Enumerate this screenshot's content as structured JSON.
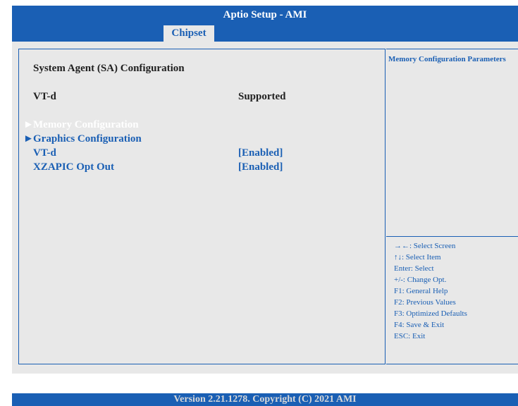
{
  "header": {
    "title": "Aptio Setup - AMI"
  },
  "tabs": [
    {
      "label": "Chipset",
      "active": true
    }
  ],
  "section_title": "System Agent (SA) Configuration",
  "info_row": {
    "label": "VT-d",
    "value": "Supported"
  },
  "menu_items": [
    {
      "label": "Memory Configuration",
      "submenu": true
    },
    {
      "label": "Graphics Configuration",
      "submenu": true
    },
    {
      "label": "VT-d",
      "value": "[Enabled]"
    },
    {
      "label": "XZAPIC Opt Out",
      "value": "[Enabled]"
    }
  ],
  "help": {
    "title": "Memory Configuration Parameters",
    "keys": [
      "→←: Select Screen",
      "↑↓: Select Item",
      "Enter: Select",
      "+/-: Change Opt.",
      "F1: General Help",
      "F2: Previous Values",
      "F3: Optimized Defaults",
      "F4: Save & Exit",
      "ESC: Exit"
    ]
  },
  "footer": {
    "text": "Version 2.21.1278. Copyright (C) 2021 AMI"
  },
  "colors": {
    "accent": "#1a5fb4",
    "panel": "#e8e8e8",
    "selected_text": "#ffffff"
  },
  "icons": {
    "submenu": "submenu-arrow-icon"
  }
}
